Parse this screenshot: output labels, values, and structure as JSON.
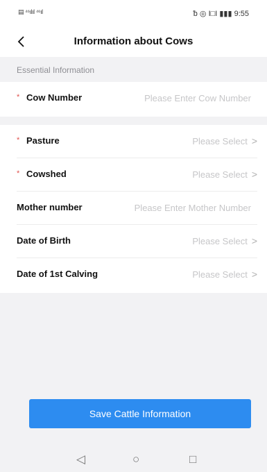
{
  "status_bar": {
    "left": "▤ ⁴⁶ılıl ⁴⁶ıl",
    "right": "ᵬ ◎ I□I ▮▮▮ 9:55"
  },
  "header": {
    "back_icon": "‹",
    "title": "Information about Cows"
  },
  "section": {
    "title": "Essential Information"
  },
  "fields": {
    "cow_number": {
      "label": "Cow Number",
      "placeholder": "Please Enter Cow Number",
      "required_mark": "*"
    },
    "pasture": {
      "label": "Pasture",
      "value": "Please Select",
      "required_mark": "*"
    },
    "cowshed": {
      "label": "Cowshed",
      "value": "Please Select",
      "required_mark": "*"
    },
    "mother_number": {
      "label": "Mother number",
      "placeholder": "Please Enter Mother Number"
    },
    "date_of_birth": {
      "label": "Date of Birth",
      "value": "Please Select"
    },
    "date_first_calving": {
      "label": "Date of 1st Calving",
      "value": "Please Select"
    }
  },
  "chevron": ">",
  "save_button": {
    "label": "Save Cattle Information"
  },
  "nav": {
    "back": "◁",
    "home": "○",
    "recent": "□"
  },
  "colors": {
    "accent": "#2d8cf0",
    "required": "#e0524e",
    "placeholder": "#c6c6c8"
  }
}
